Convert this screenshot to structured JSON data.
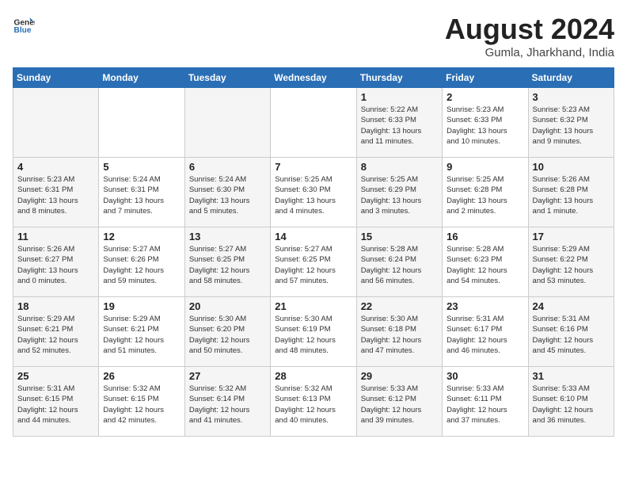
{
  "header": {
    "logo_line1": "General",
    "logo_line2": "Blue",
    "title": "August 2024",
    "subtitle": "Gumla, Jharkhand, India"
  },
  "weekdays": [
    "Sunday",
    "Monday",
    "Tuesday",
    "Wednesday",
    "Thursday",
    "Friday",
    "Saturday"
  ],
  "weeks": [
    [
      {
        "day": "",
        "info": ""
      },
      {
        "day": "",
        "info": ""
      },
      {
        "day": "",
        "info": ""
      },
      {
        "day": "",
        "info": ""
      },
      {
        "day": "1",
        "info": "Sunrise: 5:22 AM\nSunset: 6:33 PM\nDaylight: 13 hours\nand 11 minutes."
      },
      {
        "day": "2",
        "info": "Sunrise: 5:23 AM\nSunset: 6:33 PM\nDaylight: 13 hours\nand 10 minutes."
      },
      {
        "day": "3",
        "info": "Sunrise: 5:23 AM\nSunset: 6:32 PM\nDaylight: 13 hours\nand 9 minutes."
      }
    ],
    [
      {
        "day": "4",
        "info": "Sunrise: 5:23 AM\nSunset: 6:31 PM\nDaylight: 13 hours\nand 8 minutes."
      },
      {
        "day": "5",
        "info": "Sunrise: 5:24 AM\nSunset: 6:31 PM\nDaylight: 13 hours\nand 7 minutes."
      },
      {
        "day": "6",
        "info": "Sunrise: 5:24 AM\nSunset: 6:30 PM\nDaylight: 13 hours\nand 5 minutes."
      },
      {
        "day": "7",
        "info": "Sunrise: 5:25 AM\nSunset: 6:30 PM\nDaylight: 13 hours\nand 4 minutes."
      },
      {
        "day": "8",
        "info": "Sunrise: 5:25 AM\nSunset: 6:29 PM\nDaylight: 13 hours\nand 3 minutes."
      },
      {
        "day": "9",
        "info": "Sunrise: 5:25 AM\nSunset: 6:28 PM\nDaylight: 13 hours\nand 2 minutes."
      },
      {
        "day": "10",
        "info": "Sunrise: 5:26 AM\nSunset: 6:28 PM\nDaylight: 13 hours\nand 1 minute."
      }
    ],
    [
      {
        "day": "11",
        "info": "Sunrise: 5:26 AM\nSunset: 6:27 PM\nDaylight: 13 hours\nand 0 minutes."
      },
      {
        "day": "12",
        "info": "Sunrise: 5:27 AM\nSunset: 6:26 PM\nDaylight: 12 hours\nand 59 minutes."
      },
      {
        "day": "13",
        "info": "Sunrise: 5:27 AM\nSunset: 6:25 PM\nDaylight: 12 hours\nand 58 minutes."
      },
      {
        "day": "14",
        "info": "Sunrise: 5:27 AM\nSunset: 6:25 PM\nDaylight: 12 hours\nand 57 minutes."
      },
      {
        "day": "15",
        "info": "Sunrise: 5:28 AM\nSunset: 6:24 PM\nDaylight: 12 hours\nand 56 minutes."
      },
      {
        "day": "16",
        "info": "Sunrise: 5:28 AM\nSunset: 6:23 PM\nDaylight: 12 hours\nand 54 minutes."
      },
      {
        "day": "17",
        "info": "Sunrise: 5:29 AM\nSunset: 6:22 PM\nDaylight: 12 hours\nand 53 minutes."
      }
    ],
    [
      {
        "day": "18",
        "info": "Sunrise: 5:29 AM\nSunset: 6:21 PM\nDaylight: 12 hours\nand 52 minutes."
      },
      {
        "day": "19",
        "info": "Sunrise: 5:29 AM\nSunset: 6:21 PM\nDaylight: 12 hours\nand 51 minutes."
      },
      {
        "day": "20",
        "info": "Sunrise: 5:30 AM\nSunset: 6:20 PM\nDaylight: 12 hours\nand 50 minutes."
      },
      {
        "day": "21",
        "info": "Sunrise: 5:30 AM\nSunset: 6:19 PM\nDaylight: 12 hours\nand 48 minutes."
      },
      {
        "day": "22",
        "info": "Sunrise: 5:30 AM\nSunset: 6:18 PM\nDaylight: 12 hours\nand 47 minutes."
      },
      {
        "day": "23",
        "info": "Sunrise: 5:31 AM\nSunset: 6:17 PM\nDaylight: 12 hours\nand 46 minutes."
      },
      {
        "day": "24",
        "info": "Sunrise: 5:31 AM\nSunset: 6:16 PM\nDaylight: 12 hours\nand 45 minutes."
      }
    ],
    [
      {
        "day": "25",
        "info": "Sunrise: 5:31 AM\nSunset: 6:15 PM\nDaylight: 12 hours\nand 44 minutes."
      },
      {
        "day": "26",
        "info": "Sunrise: 5:32 AM\nSunset: 6:15 PM\nDaylight: 12 hours\nand 42 minutes."
      },
      {
        "day": "27",
        "info": "Sunrise: 5:32 AM\nSunset: 6:14 PM\nDaylight: 12 hours\nand 41 minutes."
      },
      {
        "day": "28",
        "info": "Sunrise: 5:32 AM\nSunset: 6:13 PM\nDaylight: 12 hours\nand 40 minutes."
      },
      {
        "day": "29",
        "info": "Sunrise: 5:33 AM\nSunset: 6:12 PM\nDaylight: 12 hours\nand 39 minutes."
      },
      {
        "day": "30",
        "info": "Sunrise: 5:33 AM\nSunset: 6:11 PM\nDaylight: 12 hours\nand 37 minutes."
      },
      {
        "day": "31",
        "info": "Sunrise: 5:33 AM\nSunset: 6:10 PM\nDaylight: 12 hours\nand 36 minutes."
      }
    ]
  ]
}
